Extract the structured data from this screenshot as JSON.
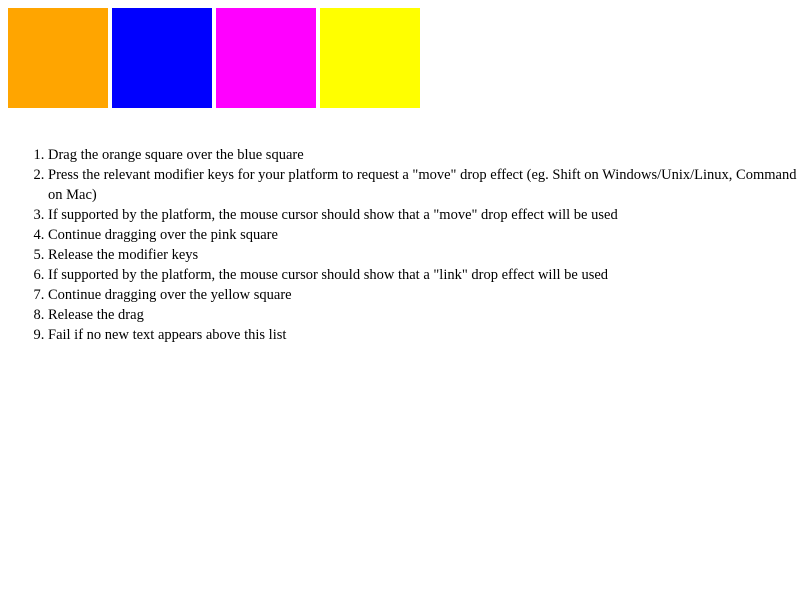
{
  "squares": [
    {
      "name": "orange",
      "color": "#FFA500"
    },
    {
      "name": "blue",
      "color": "#0000FF"
    },
    {
      "name": "pink",
      "color": "#FF00FF"
    },
    {
      "name": "yellow",
      "color": "#FFFF00"
    }
  ],
  "instructions": [
    "Drag the orange square over the blue square",
    "Press the relevant modifier keys for your platform to request a \"move\" drop effect (eg. Shift on Windows/Unix/Linux, Command on Mac)",
    "If supported by the platform, the mouse cursor should show that a \"move\" drop effect will be used",
    "Continue dragging over the pink square",
    "Release the modifier keys",
    "If supported by the platform, the mouse cursor should show that a \"link\" drop effect will be used",
    "Continue dragging over the yellow square",
    "Release the drag",
    "Fail if no new text appears above this list"
  ]
}
